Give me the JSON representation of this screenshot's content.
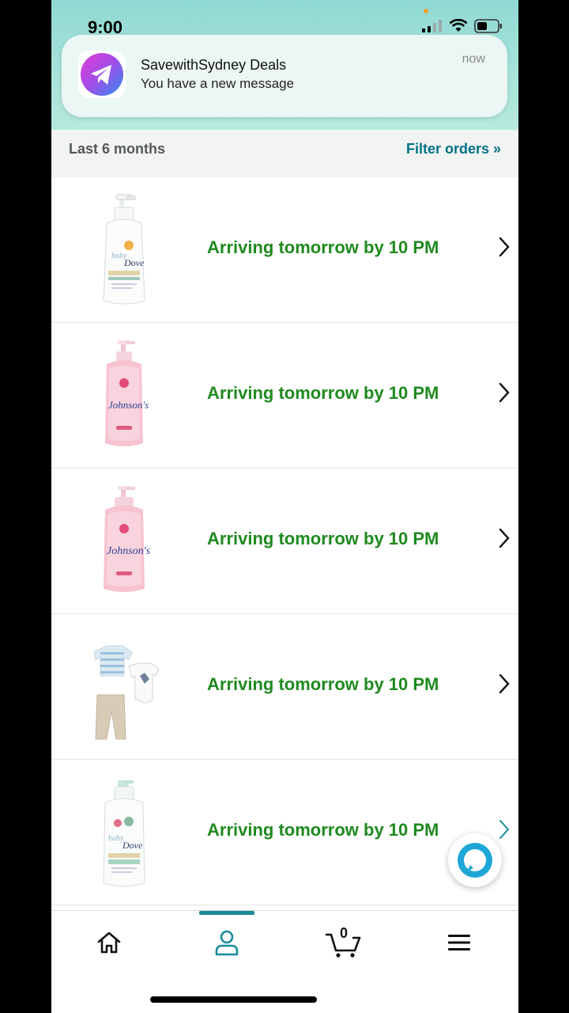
{
  "status_bar": {
    "time": "9:00"
  },
  "notification": {
    "app_title": "SavewithSydney Deals",
    "message": "You have a new message",
    "time": "now"
  },
  "filter": {
    "period": "Last 6 months",
    "link": "Filter orders »"
  },
  "orders": [
    {
      "status": "Arriving tomorrow by 10 PM",
      "product_icon": "baby-dove-lotion-bottle"
    },
    {
      "status": "Arriving tomorrow by 10 PM",
      "product_icon": "johnsons-pink-lotion-bottle"
    },
    {
      "status": "Arriving tomorrow by 10 PM",
      "product_icon": "johnsons-pink-lotion-bottle"
    },
    {
      "status": "Arriving tomorrow by 10 PM",
      "product_icon": "baby-clothing-set"
    },
    {
      "status": "Arriving tomorrow by 10 PM",
      "product_icon": "baby-dove-wash-bottle"
    }
  ],
  "bottom_nav": {
    "items": [
      "home-icon",
      "account-icon",
      "cart-icon",
      "menu-icon"
    ],
    "cart_count": "0",
    "active": "account-icon"
  },
  "colors": {
    "status_green": "#1f8a1f",
    "link_teal": "#007185",
    "accent_teal": "#1a8a9a"
  }
}
